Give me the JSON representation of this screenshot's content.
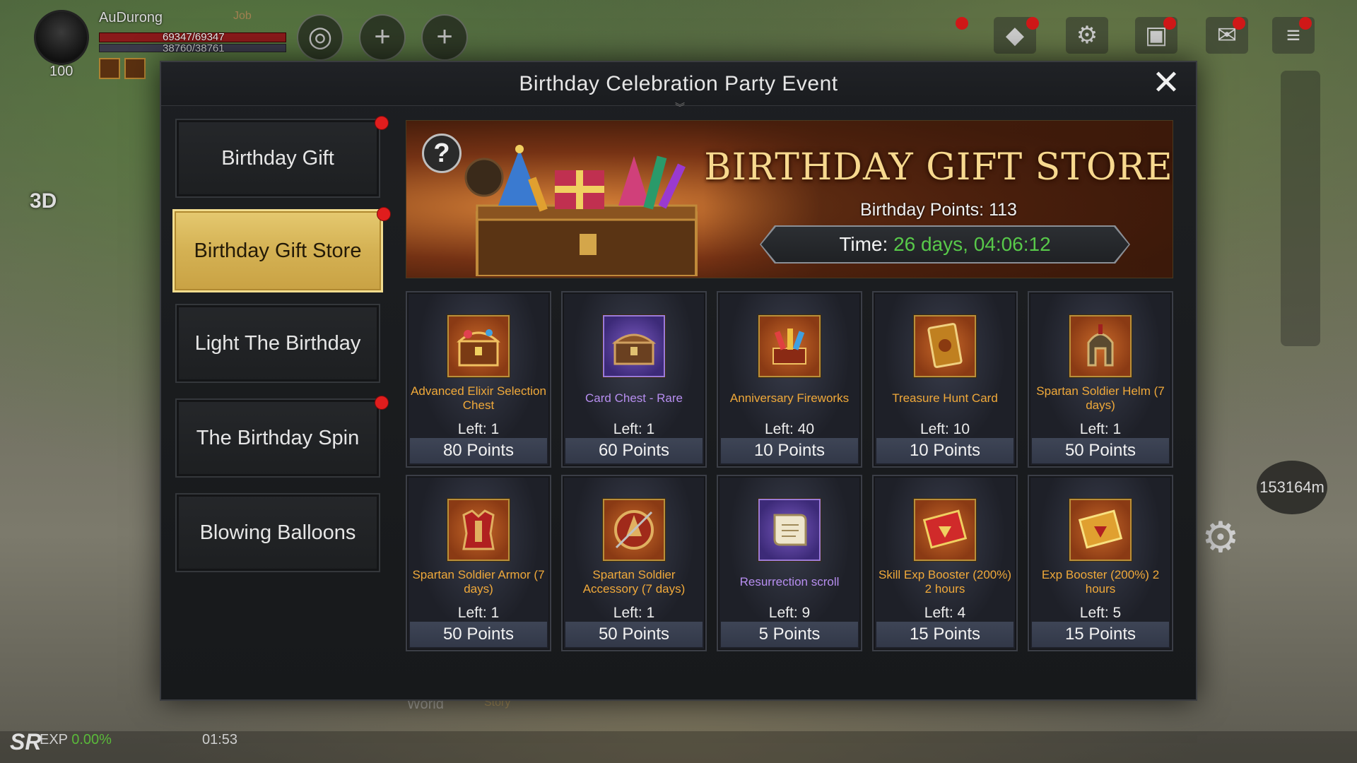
{
  "hud": {
    "player_name": "AuDurong",
    "job": "Job",
    "level": "100",
    "hp": "69347/69347",
    "mp": "38760/38761",
    "exp_label": "EXP",
    "exp_value": "0.00%",
    "clock": "01:53",
    "distance": "153164m",
    "view_mode": "3D",
    "world_label": "World",
    "story_label": "Story",
    "logo": "SR"
  },
  "modal": {
    "title": "Birthday Celebration Party Event",
    "close_symbol": "✕"
  },
  "sidebar": {
    "items": [
      {
        "label": "Birthday Gift",
        "active": false,
        "dot": true
      },
      {
        "label": "Birthday Gift Store",
        "active": true,
        "dot": true
      },
      {
        "label": "Light The Birthday",
        "active": false,
        "dot": false
      },
      {
        "label": "The Birthday Spin",
        "active": false,
        "dot": true
      },
      {
        "label": "Blowing Balloons",
        "active": false,
        "dot": false
      }
    ]
  },
  "banner": {
    "help_symbol": "?",
    "title": "BIRTHDAY GIFT STORE",
    "points_text": "Birthday Points: 113",
    "time_label": "Time:",
    "time_value": "26 days, 04:06:12"
  },
  "items": [
    {
      "name": "Advanced Elixir Selection Chest",
      "left": "Left: 1",
      "price": "80 Points",
      "rarity": "orange",
      "icon": "treasure-chest-icon"
    },
    {
      "name": "Card Chest - Rare",
      "left": "Left: 1",
      "price": "60 Points",
      "rarity": "purple",
      "icon": "card-chest-icon"
    },
    {
      "name": "Anniversary Fireworks",
      "left": "Left: 40",
      "price": "10 Points",
      "rarity": "orange",
      "icon": "fireworks-icon"
    },
    {
      "name": "Treasure Hunt Card",
      "left": "Left: 10",
      "price": "10 Points",
      "rarity": "orange",
      "icon": "treasure-card-icon"
    },
    {
      "name": "Spartan Soldier Helm (7 days)",
      "left": "Left: 1",
      "price": "50 Points",
      "rarity": "orange",
      "icon": "helm-icon"
    },
    {
      "name": "Spartan Soldier Armor (7 days)",
      "left": "Left: 1",
      "price": "50 Points",
      "rarity": "orange",
      "icon": "armor-icon"
    },
    {
      "name": "Spartan Soldier Accessory (7 days)",
      "left": "Left: 1",
      "price": "50 Points",
      "rarity": "orange",
      "icon": "shield-accessory-icon"
    },
    {
      "name": "Resurrection scroll",
      "left": "Left: 9",
      "price": "5 Points",
      "rarity": "purple",
      "icon": "scroll-icon"
    },
    {
      "name": "Skill Exp Booster (200%) 2 hours",
      "left": "Left: 4",
      "price": "15 Points",
      "rarity": "orange",
      "icon": "skill-booster-icon"
    },
    {
      "name": "Exp Booster (200%) 2 hours",
      "left": "Left: 5",
      "price": "15 Points",
      "rarity": "orange",
      "icon": "exp-booster-icon"
    }
  ],
  "colors": {
    "gold_active": "#d4b153",
    "orange_text": "#f0a93a",
    "purple_text": "#b78ef0",
    "timer_green": "#58c94a",
    "notify_red": "#e01d1d"
  }
}
